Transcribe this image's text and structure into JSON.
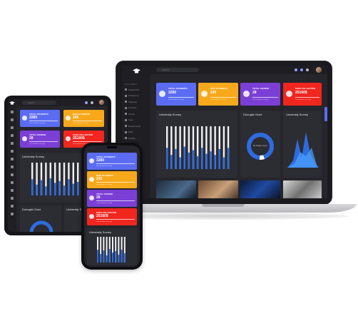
{
  "colors": {
    "blue": "#5b6cf2",
    "orange": "#f7a81b",
    "purple": "#7b3fd6",
    "red": "#f0261f",
    "screen_bg": "#25252b",
    "chart_blue": "#2d6cdf"
  },
  "laptop": {
    "search_placeholder": "Search",
    "sidebar_heading": "MAIN MENU",
    "sidebar_items": [
      "Dashboard",
      "Professors",
      "Students",
      "Courses",
      "Library",
      "Fees",
      "Departments",
      "Staff",
      "Holiday",
      "Events"
    ],
    "cards": [
      {
        "title": "TOTAL STUDENTS",
        "value": "3280",
        "sub": "80% Increase in 20 Days",
        "color": "blue"
      },
      {
        "title": "NEW STUDENTS",
        "value": "245",
        "sub": "50% Increase in 25 Days",
        "color": "orange"
      },
      {
        "title": "TOTAL COURSE",
        "value": "28",
        "sub": "76% Increase in 20 Days",
        "color": "purple"
      },
      {
        "title": "FEES COLLECTION",
        "value": "25160$",
        "sub": "30% Increase in 30 Days",
        "color": "red"
      }
    ],
    "panels": {
      "survey_title": "University Survey",
      "donut_title": "Donught Chart",
      "survey2_title": "University Survey",
      "donut_center": "By Subject Count"
    }
  },
  "tablet": {
    "search_placeholder": "Search",
    "cards": [
      {
        "title": "TOTAL STUDENTS",
        "value": "3280",
        "sub": "80% Increase in 20 Days",
        "color": "blue"
      },
      {
        "title": "NEW STUDENTS",
        "value": "245",
        "sub": "50% Increase in 25 Days",
        "color": "orange"
      },
      {
        "title": "TOTAL COURSE",
        "value": "28",
        "sub": "76% Increase in 20 Days",
        "color": "purple"
      },
      {
        "title": "FEES COLLECTION",
        "value": "25160$",
        "sub": "30% Increase in 30 Days",
        "color": "red"
      }
    ],
    "panels": {
      "survey_title": "University Survey",
      "donut_title": "Donught Chart",
      "survey2_title": "University Survey"
    }
  },
  "phone": {
    "cards": [
      {
        "title": "TOTAL STUDENTS",
        "value": "3280",
        "sub": "80% Increase in 20 Days",
        "color": "blue"
      },
      {
        "title": "NEW STUDENTS",
        "value": "245",
        "sub": "50% Increase in 25 Days",
        "color": "orange"
      },
      {
        "title": "TOTAL COURSE",
        "value": "28",
        "sub": "76% Increase in 20 Days",
        "color": "purple"
      },
      {
        "title": "FEES COLLECTION",
        "value": "25160$",
        "sub": "30% Increase in 30 Days",
        "color": "red"
      }
    ],
    "panels": {
      "survey_title": "University Survey"
    }
  },
  "icons": [
    "graduation-cap-icon",
    "search-icon",
    "bell-icon",
    "mail-icon",
    "settings-icon",
    "menu-icon"
  ],
  "bar_pattern": [
    0.9,
    0.6,
    0.85,
    0.5,
    0.95,
    0.7,
    0.8,
    0.55,
    0.9,
    0.65,
    0.75,
    0.6,
    0.85,
    0.5,
    0.9
  ]
}
